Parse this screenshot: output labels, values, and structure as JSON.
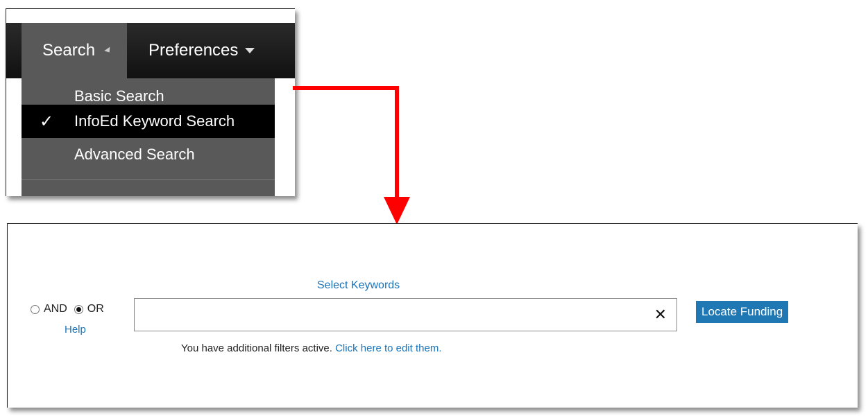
{
  "menu": {
    "tabs": [
      {
        "label": "Search"
      },
      {
        "label": "Preferences"
      }
    ],
    "dropdown_items": [
      {
        "label": "Basic Search",
        "checked": false
      },
      {
        "label": "InfoEd Keyword Search",
        "checked": true
      },
      {
        "label": "Advanced Search",
        "checked": false
      }
    ],
    "check_glyph": "✓"
  },
  "search_panel": {
    "select_keywords_label": "Select Keywords",
    "radio_and_label": "AND",
    "radio_or_label": "OR",
    "selected_operator": "OR",
    "help_label": "Help",
    "keyword_input_value": "",
    "clear_glyph": "✕",
    "locate_button_label": "Locate Funding",
    "filters_text": "You have additional filters active.",
    "filters_link": "Click here to edit them."
  },
  "colors": {
    "arrow": "#ff0000",
    "link": "#1a73b8",
    "button": "#1f78b4"
  }
}
